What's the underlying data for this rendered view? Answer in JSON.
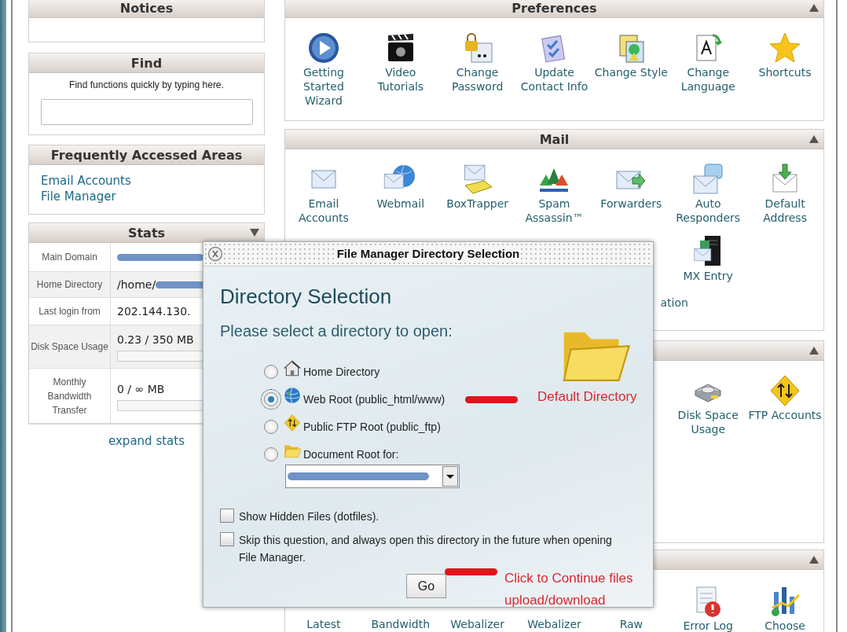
{
  "sidebar": {
    "notices": {
      "title": "Notices"
    },
    "find": {
      "title": "Find",
      "hint": "Find functions quickly by typing here."
    },
    "frequent": {
      "title": "Frequently Accessed Areas",
      "links": [
        "Email Accounts",
        "File Manager"
      ]
    },
    "stats": {
      "title": "Stats",
      "rows": [
        {
          "kind": "redacted",
          "label": "Main Domain"
        },
        {
          "kind": "redacted",
          "label": "Home Directory",
          "value": "/home/"
        },
        {
          "kind": "text",
          "label": "Last login from",
          "value": "202.144.130."
        },
        {
          "kind": "meter",
          "label": "Disk Space Usage",
          "value": "0.23 / 350 MB"
        },
        {
          "kind": "meter",
          "label": "Monthly Bandwidth Transfer",
          "value": "0 / ∞ MB"
        }
      ],
      "expand_link": "expand stats"
    }
  },
  "sections": [
    {
      "title": "Preferences",
      "items": [
        "Getting Started Wizard",
        "Video Tutorials",
        "Change Password",
        "Update Contact Info",
        "Change Style",
        "Change Language",
        "Shortcuts"
      ]
    },
    {
      "title": "Mail",
      "items": [
        "Email Accounts",
        "Webmail",
        "BoxTrapper",
        "Spam Assassin™",
        "Forwarders",
        "Auto Responders",
        "Default Address",
        "ation",
        "MX Entry"
      ]
    },
    {
      "items": [
        "Disk Space Usage",
        "FTP Accounts"
      ]
    },
    {
      "items": [
        "Latest",
        "Bandwidth",
        "Webalizer",
        "Webalizer",
        "Raw",
        "Error Log",
        "Choose"
      ]
    }
  ],
  "dialog": {
    "title": "File Manager Directory Selection",
    "heading": "Directory Selection",
    "prompt": "Please select a directory to open:",
    "options": [
      {
        "label": "Home Directory",
        "selected": false
      },
      {
        "label": "Web Root (public_html/www)",
        "selected": true
      },
      {
        "label": "Public FTP Root (public_ftp)",
        "selected": false
      },
      {
        "label": "Document Root for:",
        "selected": false
      }
    ],
    "checkboxes": [
      {
        "label": "Show Hidden Files (dotfiles).",
        "checked": false
      },
      {
        "label": "Skip this question, and always open this directory in the future when opening File Manager.",
        "checked": false
      }
    ],
    "go_button": "Go"
  },
  "annotations": [
    "Default Directory",
    "Click to Continue files upload/download"
  ]
}
